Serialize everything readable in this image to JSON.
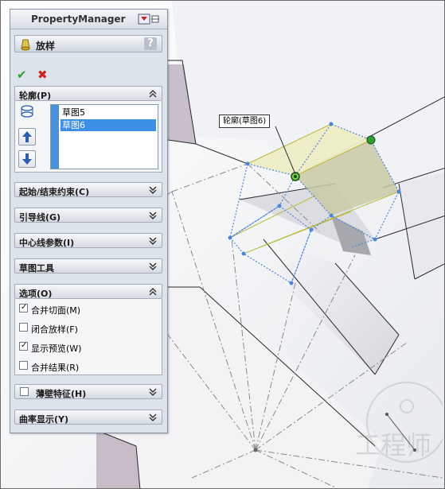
{
  "app": {
    "title": "PropertyManager"
  },
  "feature": {
    "name": "放样",
    "help_symbol": "?"
  },
  "actions": {
    "ok_symbol": "✔",
    "cancel_symbol": "✖"
  },
  "profiles": {
    "header": "轮廓(P)",
    "items": [
      "草图5",
      "草图6"
    ],
    "selected_index": 1
  },
  "sections": {
    "start_end": "起始/结束约束(C)",
    "guide_curves": "引导线(G)",
    "centerline": "中心线参数(I)",
    "sketch_tools": "草图工具",
    "options": "选项(O)",
    "thin": "薄壁特征(H)",
    "curvature": "曲率显示(Y)"
  },
  "options": [
    {
      "label": "合并切面(M)",
      "checked": true
    },
    {
      "label": "闭合放样(F)",
      "checked": false
    },
    {
      "label": "显示预览(W)",
      "checked": true
    },
    {
      "label": "合并结果(R)",
      "checked": false
    }
  ],
  "thin_checked": false,
  "canvas": {
    "callout": "轮廓(草图6)"
  },
  "colors": {
    "selection": "#3d8ee6",
    "accent_green": "#2e9e2e",
    "cancel_red": "#d02020",
    "annotation_red": "#d81a1a"
  },
  "icons": [
    "loft-icon",
    "help-icon",
    "ok-check-icon",
    "cancel-x-icon",
    "profile-icon",
    "move-up-icon",
    "move-down-icon",
    "pin-icon",
    "chevron-up-icon",
    "chevron-down-icon"
  ]
}
